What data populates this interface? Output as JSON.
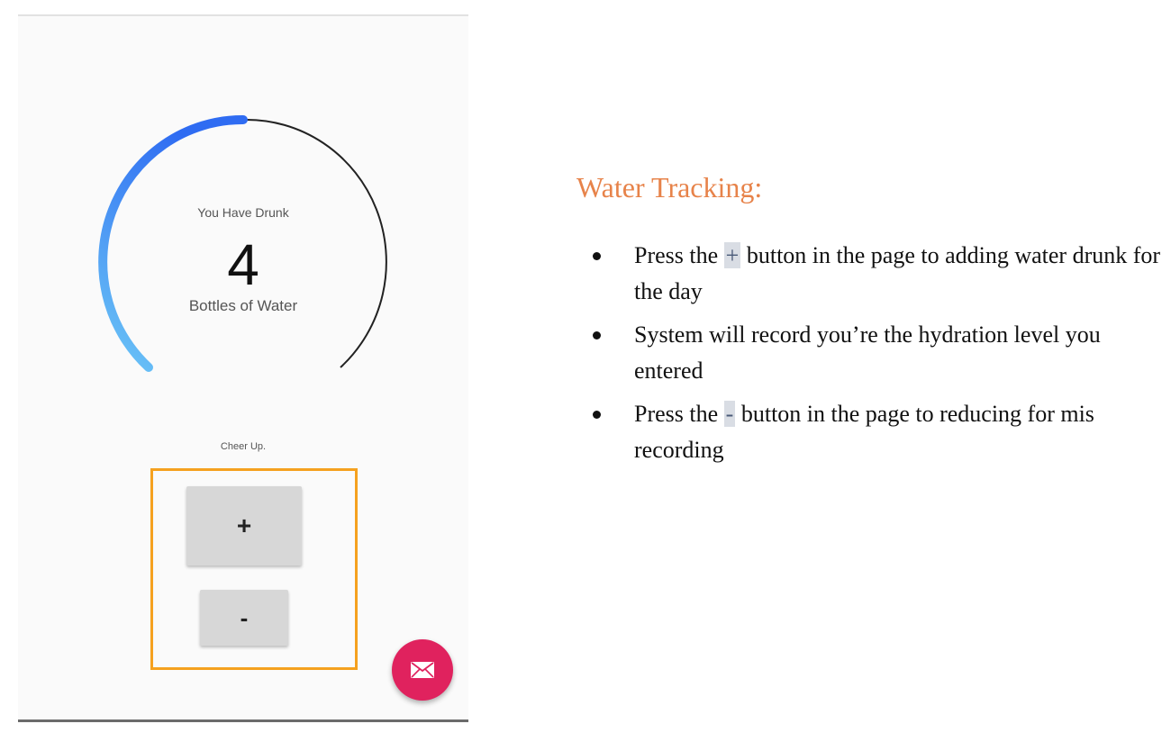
{
  "tracker": {
    "gauge": {
      "caption": "You Have Drunk",
      "count": "4",
      "unit": "Bottles of Water",
      "progress_fraction": 0.4,
      "track_color": "#222222",
      "progress_color_start": "#2f6cf2",
      "progress_color_end": "#6cc6f6"
    },
    "cheer_text": "Cheer Up.",
    "plus_label": "+",
    "minus_label": "-",
    "highlight_color": "#f5a11f",
    "fab": {
      "icon": "mail-icon",
      "color": "#e0225e"
    }
  },
  "instructions": {
    "title": "Water Tracking:",
    "title_color": "#e7834a",
    "items": [
      {
        "before": "Press the ",
        "key": "+",
        "after": " button in the page to adding water drunk for the day"
      },
      {
        "text": "System will record you’re the hydration level you entered"
      },
      {
        "before": "Press the ",
        "key": "-",
        "after": " button in the page to reducing for mis recording"
      }
    ]
  }
}
